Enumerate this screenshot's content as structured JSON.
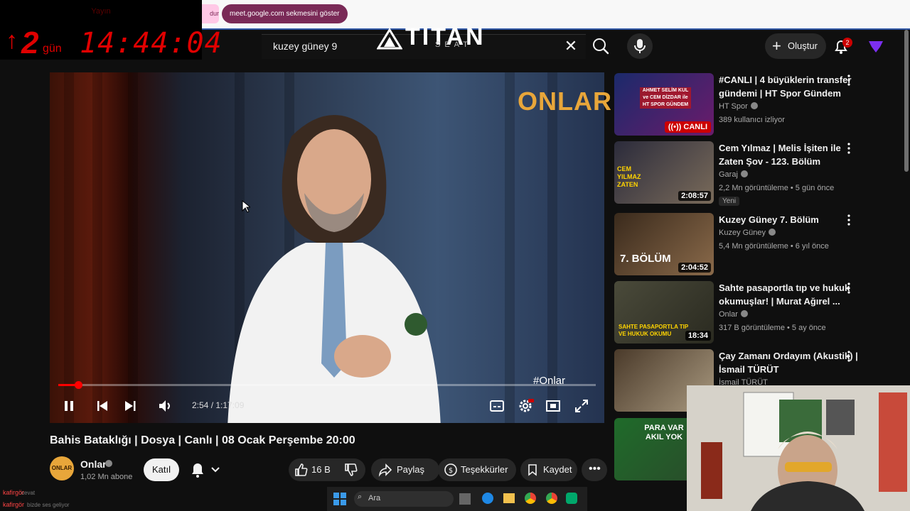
{
  "browser": {
    "notice_fragment": "dur",
    "meet_notice": "meet.google.com sekmesini göster"
  },
  "overlay": {
    "top_label": "Yayın",
    "days": "2",
    "days_label": "gün",
    "clock": "14:44:04"
  },
  "masthead": {
    "search_value": "kuzey güney 9",
    "brand_logo": "TITAN",
    "brand_sub": "SEAT",
    "create_label": "Oluştur",
    "notification_count": "2"
  },
  "player": {
    "watermark": "ONLAR",
    "hashtag": "#Onlar",
    "time": "2:54 / 1:17:09",
    "progress": 0.037
  },
  "video": {
    "title": "Bahis Bataklığı | Dosya | Canlı | 08 Ocak Perşembe 20:00",
    "channel": "Onlar",
    "avatar_text": "ONLAR",
    "subscribers": "1,02 Mn abone",
    "join_label": "Katıl",
    "likes": "16 B",
    "share_label": "Paylaş",
    "thanks_label": "Teşekkürler",
    "save_label": "Kaydet"
  },
  "recommendations": [
    {
      "title": "#CANLI | 4 büyüklerin transfer gündemi | HT Spor Gündem",
      "channel": "HT Spor",
      "meta": "389 kullanıcı izliyor",
      "badge": "CANLI",
      "thumb_text": "AHMET SELİM KUL ve CEM DİZDAR ile HT SPOR GÜNDEM"
    },
    {
      "title": "Cem Yılmaz | Melis İşiten ile Zaten Şov - 123. Bölüm",
      "channel": "Garaj",
      "meta": "2,2 Mn görüntüleme • 5 gün önce",
      "duration": "2:08:57",
      "new_label": "Yeni",
      "thumb_text": "CEM YILMAZ ZATEN"
    },
    {
      "title": "Kuzey Güney 7. Bölüm",
      "channel": "Kuzey Güney",
      "meta": "5,4 Mn görüntüleme • 6 yıl önce",
      "duration": "2:04:52",
      "thumb_text": "7. BÖLÜM"
    },
    {
      "title": "Sahte pasaportla tıp ve hukuk okumuşlar! | Murat Ağırel ...",
      "channel": "Onlar",
      "meta": "317 B görüntüleme • 5 ay önce",
      "duration": "18:34",
      "thumb_text": "SAHTE PASAPORTLA TIP VE HUKUK OKUMU"
    },
    {
      "title": "Çay Zamanı Ordayım (Akustik) | İsmail TÜRÜT",
      "channel": "İsmail TÜRÜT"
    },
    {
      "thumb_text": "PARA VAR AKIL YOK"
    }
  ],
  "taskbar": {
    "search_placeholder": "Ara"
  },
  "chat": {
    "user1": "kafirgör",
    "msg1": "cevat",
    "user2": "kafirgör",
    "msg2": "bizde ses geliyor"
  }
}
